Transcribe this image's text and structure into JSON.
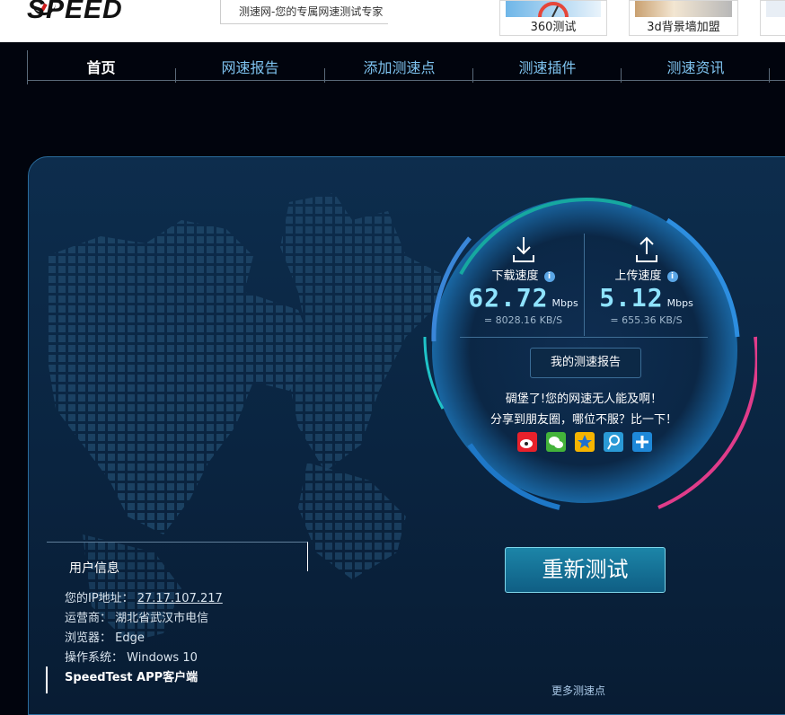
{
  "header": {
    "logo_text": "SPEED",
    "slogan": "测速网-您的专属网速测试专家",
    "ads": [
      {
        "label": "360测试"
      },
      {
        "label": "3d背景墙加盟"
      }
    ]
  },
  "nav": {
    "items": [
      {
        "label": "首页",
        "active": true
      },
      {
        "label": "网速报告"
      },
      {
        "label": "添加测速点"
      },
      {
        "label": "测速插件"
      },
      {
        "label": "测速资讯"
      }
    ]
  },
  "result": {
    "download": {
      "label": "下载速度",
      "value": "62.72",
      "unit": "Mbps",
      "kbs": "= 8028.16  KB/S"
    },
    "upload": {
      "label": "上传速度",
      "value": "5.12",
      "unit": "Mbps",
      "kbs": "= 655.36  KB/S"
    },
    "info_glyph": "i",
    "report_button": "我的测速报告",
    "message_line1": "碉堡了!您的网速无人能及啊！",
    "message_line2": "分享到朋友圈，哪位不服？比一下！",
    "share": [
      {
        "icon": "weibo-icon",
        "color": "#e8212b"
      },
      {
        "icon": "wechat-icon",
        "color": "#43b33a"
      },
      {
        "icon": "qzone-icon",
        "color": "#f5b400"
      },
      {
        "icon": "tencent-weibo-icon",
        "color": "#2a9ad6"
      },
      {
        "icon": "more-share-icon",
        "color": "#1e88d8"
      }
    ],
    "retest_button": "重新测试"
  },
  "user_info": {
    "title": "用户信息",
    "ip_label": "您的IP地址：",
    "ip": "27.17.107.217",
    "isp_label": "运营商：",
    "isp": "湖北省武汉市电信",
    "browser_label": "浏览器：",
    "browser": "Edge",
    "os_label": "操作系统：",
    "os": "Windows 10",
    "app": "SpeedTest APP客户端"
  },
  "more_points": "更多测速点"
}
